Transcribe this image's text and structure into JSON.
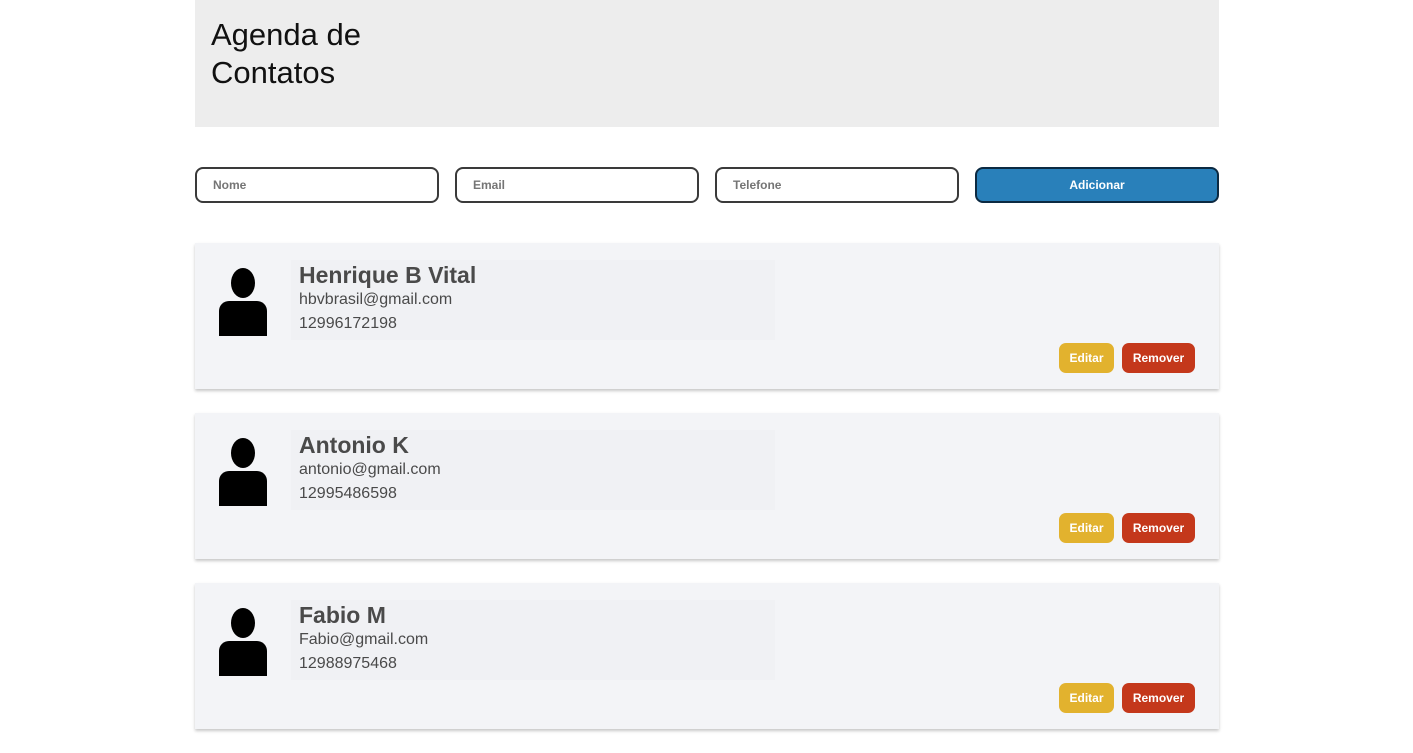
{
  "header": {
    "title": "Agenda de Contatos"
  },
  "form": {
    "name_placeholder": "Nome",
    "email_placeholder": "Email",
    "phone_placeholder": "Telefone",
    "add_label": "Adicionar"
  },
  "contacts": [
    {
      "name": "Henrique B Vital",
      "email": "hbvbrasil@gmail.com",
      "phone": "12996172198"
    },
    {
      "name": "Antonio K",
      "email": "antonio@gmail.com",
      "phone": "12995486598"
    },
    {
      "name": "Fabio M",
      "email": "Fabio@gmail.com",
      "phone": "12988975468"
    }
  ],
  "actions": {
    "edit_label": "Editar",
    "remove_label": "Remover"
  },
  "icons": {
    "avatar": "person-icon"
  },
  "colors": {
    "header_bg": "#ededed",
    "add_button": "#2980ba",
    "edit_button": "#e2b22e",
    "remove_button": "#c4381b",
    "card_bg": "#f3f4f7"
  }
}
